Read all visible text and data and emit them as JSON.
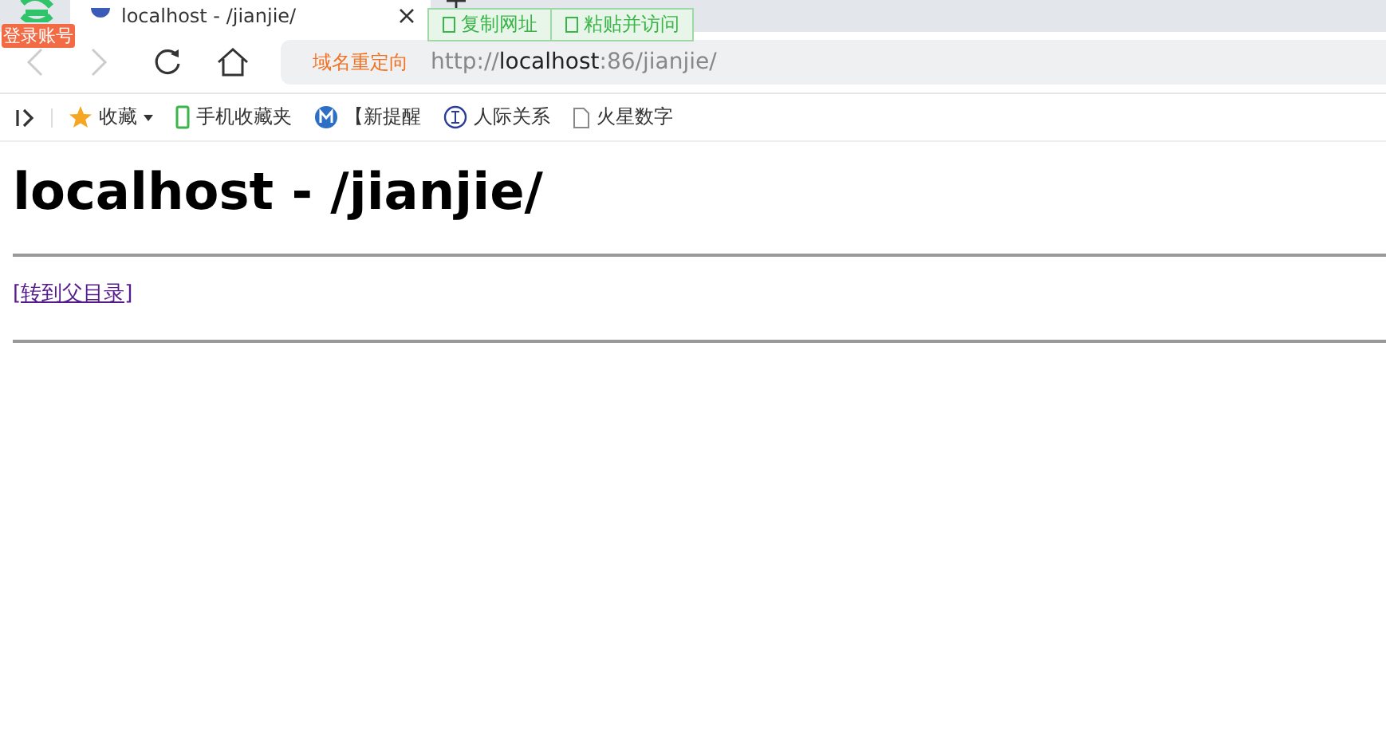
{
  "browser": {
    "login_badge": "登录账号",
    "tab": {
      "title": "localhost - /jianjie/",
      "selected": true
    },
    "popup_buttons": [
      "复制网址",
      "粘贴并访问"
    ],
    "redirect_label": "域名重定向",
    "url": {
      "scheme": "http://",
      "host": "localhost",
      "rest": ":86/jianjie/"
    },
    "bookmarks": [
      {
        "kind": "star",
        "label": "收藏"
      },
      {
        "kind": "phone",
        "label": "手机收藏夹"
      },
      {
        "kind": "m",
        "label": "【新提醒"
      },
      {
        "kind": "seal",
        "label": "人际关系"
      },
      {
        "kind": "page",
        "label": "火星数字"
      }
    ]
  },
  "page": {
    "heading": "localhost - /jianjie/",
    "parent_link": "[转到父目录]"
  }
}
